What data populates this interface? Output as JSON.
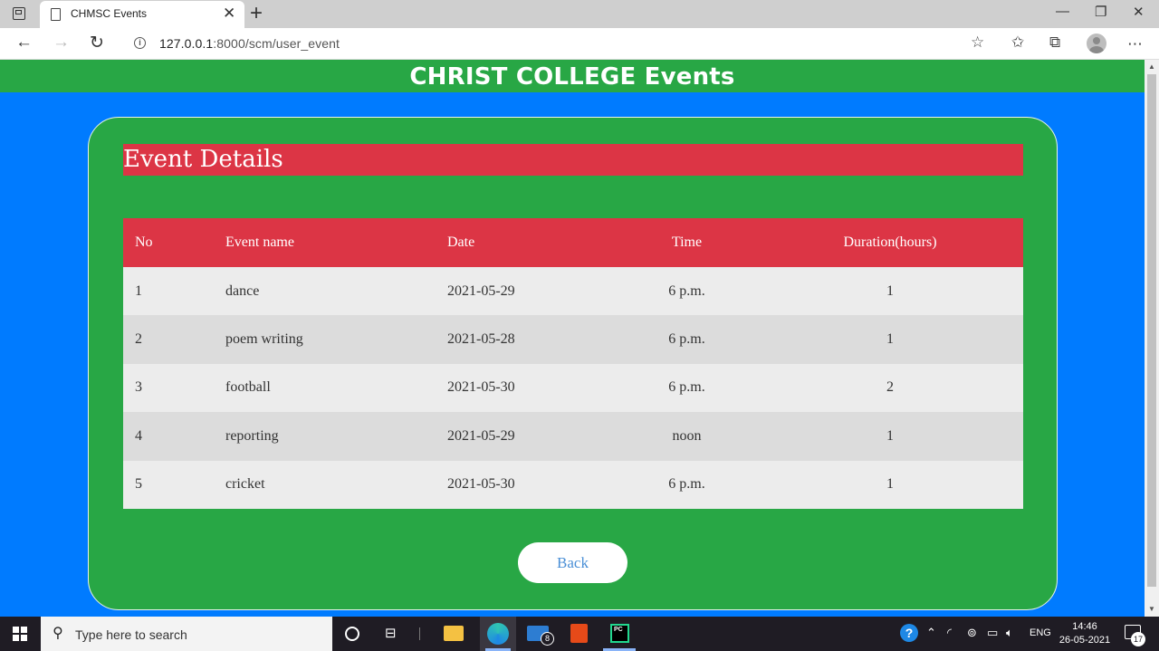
{
  "browser": {
    "tab_title": "CHMSC Events",
    "url_host": "127.0.0.1",
    "url_path": ":8000/scm/user_event"
  },
  "page": {
    "site_title": "CHRIST COLLEGE Events",
    "section_title": "Event Details",
    "back_label": "Back",
    "columns": [
      "No",
      "Event name",
      "Date",
      "Time",
      "Duration(hours)"
    ],
    "rows": [
      {
        "no": "1",
        "name": "dance",
        "date": "2021-05-29",
        "time": "6 p.m.",
        "duration": "1"
      },
      {
        "no": "2",
        "name": "poem writing",
        "date": "2021-05-28",
        "time": "6 p.m.",
        "duration": "1"
      },
      {
        "no": "3",
        "name": "football",
        "date": "2021-05-30",
        "time": "6 p.m.",
        "duration": "2"
      },
      {
        "no": "4",
        "name": "reporting",
        "date": "2021-05-29",
        "time": "noon",
        "duration": "1"
      },
      {
        "no": "5",
        "name": "cricket",
        "date": "2021-05-30",
        "time": "6 p.m.",
        "duration": "1"
      }
    ],
    "colors": {
      "background": "#007bff",
      "header_green": "#28a745",
      "accent_red": "#dc3545"
    }
  },
  "taskbar": {
    "search_placeholder": "Type here to search",
    "mail_badge": "8",
    "language": "ENG",
    "time": "14:46",
    "date": "26-05-2021",
    "notification_count": "17"
  }
}
